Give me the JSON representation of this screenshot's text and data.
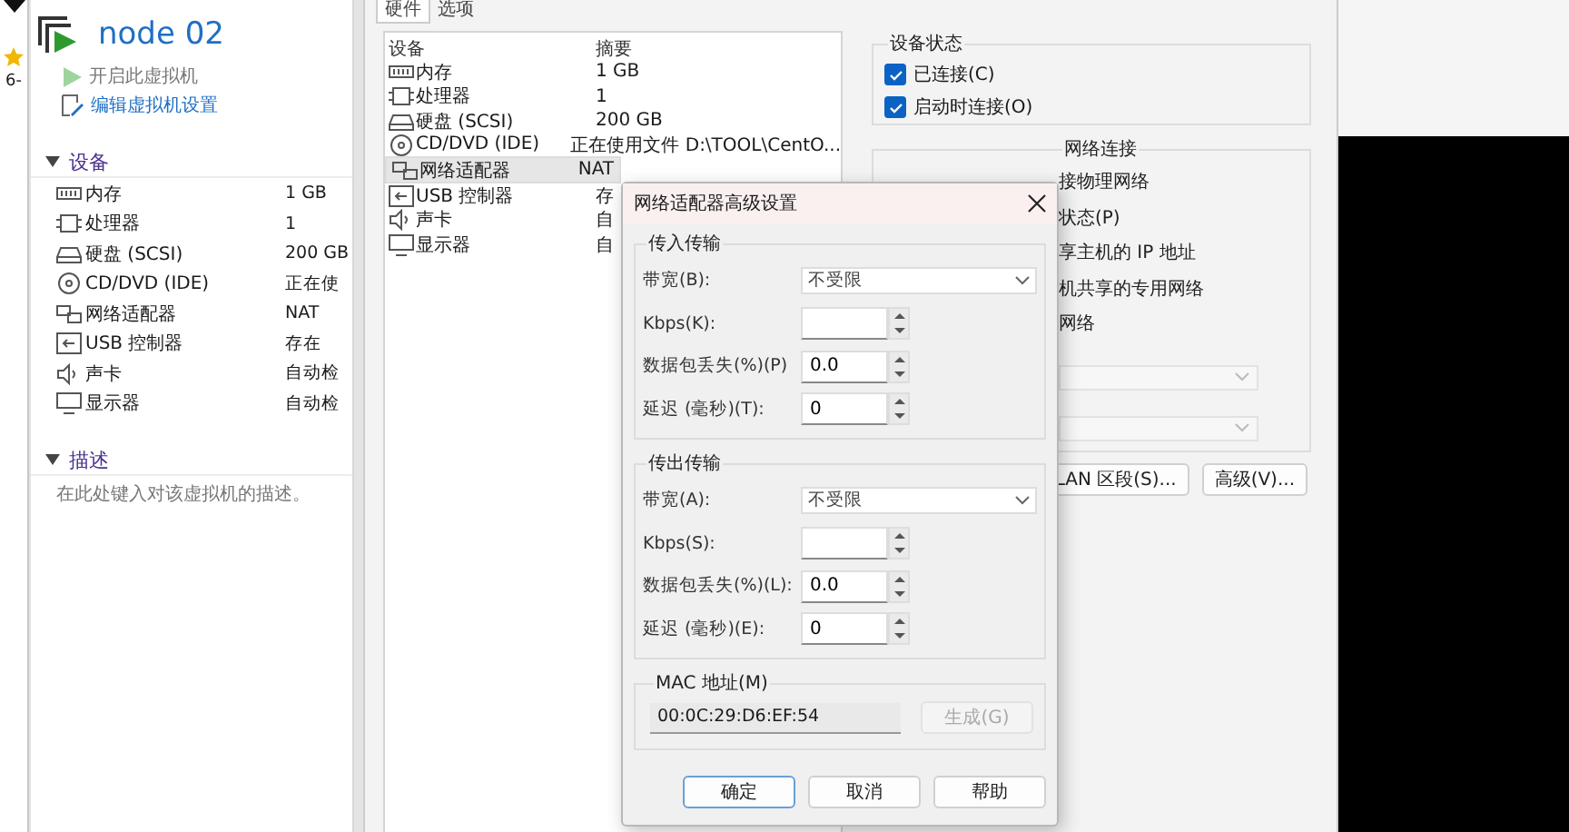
{
  "side_strip": {
    "text": "6-"
  },
  "vm_panel": {
    "title": "node 02",
    "actions": [
      {
        "kind": "power",
        "label": "开启此虚拟机",
        "disabled": true
      },
      {
        "kind": "edit",
        "label": "编辑虚拟机设置",
        "disabled": false
      }
    ],
    "devices": {
      "title": "设备",
      "expanded": true,
      "items": [
        {
          "kind": "memory",
          "name": "内存",
          "value": "1 GB"
        },
        {
          "kind": "cpu",
          "name": "处理器",
          "value": "1"
        },
        {
          "kind": "disk",
          "name": "硬盘 (SCSI)",
          "value": "200 GB"
        },
        {
          "kind": "cd",
          "name": "CD/DVD (IDE)",
          "value": "正在使"
        },
        {
          "kind": "network",
          "name": "网络适配器",
          "value": "NAT"
        },
        {
          "kind": "usb",
          "name": "USB 控制器",
          "value": "存在"
        },
        {
          "kind": "sound",
          "name": "声卡",
          "value": "自动检"
        },
        {
          "kind": "display",
          "name": "显示器",
          "value": "自动检"
        }
      ]
    },
    "description": {
      "title": "描述",
      "expanded": true,
      "text": "在此处键入对该虚拟机的描述。"
    }
  },
  "settings": {
    "tabs": [
      {
        "label": "硬件",
        "selected": true
      },
      {
        "label": "选项",
        "selected": false
      }
    ],
    "device_table": {
      "columns": [
        "设备",
        "摘要"
      ],
      "rows": [
        {
          "kind": "memory",
          "device": "内存",
          "summary": "1 GB",
          "selected": false
        },
        {
          "kind": "cpu",
          "device": "处理器",
          "summary": "1",
          "selected": false
        },
        {
          "kind": "disk",
          "device": "硬盘 (SCSI)",
          "summary": "200 GB",
          "selected": false
        },
        {
          "kind": "cd",
          "device": "CD/DVD (IDE)",
          "summary": "正在使用文件 D:\\TOOL\\CentO...",
          "selected": false
        },
        {
          "kind": "network",
          "device": "网络适配器",
          "summary": "NAT",
          "selected": true
        },
        {
          "kind": "usb",
          "device": "USB 控制器",
          "summary": "存",
          "selected": false
        },
        {
          "kind": "sound",
          "device": "声卡",
          "summary": "自",
          "selected": false
        },
        {
          "kind": "display",
          "device": "显示器",
          "summary": "自",
          "selected": false
        }
      ]
    },
    "device_status": {
      "title": "设备状态",
      "checkboxes": [
        {
          "label": "已连接(C)",
          "checked": true
        },
        {
          "label": "启动时连接(O)",
          "checked": true
        }
      ]
    },
    "network_connection": {
      "title": "网络连接",
      "lines": [
        "接物理网络",
        "状态(P)",
        "享主机的 IP 地址",
        "机共享的专用网络",
        "网络"
      ],
      "dropdowns": [
        {
          "disabled": true
        },
        {
          "disabled": true
        }
      ],
      "buttons": [
        "LAN 区段(S)...",
        "高级(V)..."
      ]
    }
  },
  "dialog": {
    "title": "网络适配器高级设置",
    "groups": [
      {
        "title": "传入传输",
        "rows": [
          {
            "kind": "select",
            "label": "带宽(B):",
            "value": "不受限"
          },
          {
            "kind": "spinner",
            "label": "Kbps(K):"
          },
          {
            "kind": "spinner",
            "label": "数据包丢失(%)(P)",
            "value": "0.0"
          },
          {
            "kind": "spinner",
            "label": "延迟 (毫秒)(T):",
            "value": "0"
          }
        ]
      },
      {
        "title": "传出传输",
        "rows": [
          {
            "kind": "select",
            "label": "带宽(A):",
            "value": "不受限"
          },
          {
            "kind": "spinner",
            "label": "Kbps(S):"
          },
          {
            "kind": "spinner",
            "label": "数据包丢失(%)(L):",
            "value": "0.0"
          },
          {
            "kind": "spinner",
            "label": "延迟 (毫秒)(E):",
            "value": "0"
          }
        ]
      }
    ],
    "mac": {
      "title": "MAC 地址(M)",
      "value": "00:0C:29:D6:EF:54",
      "button": {
        "label": "生成(G)",
        "disabled": true
      }
    },
    "buttons": [
      {
        "label": "确定",
        "default": true
      },
      {
        "label": "取消",
        "default": false
      },
      {
        "label": "帮助",
        "default": false
      }
    ]
  }
}
